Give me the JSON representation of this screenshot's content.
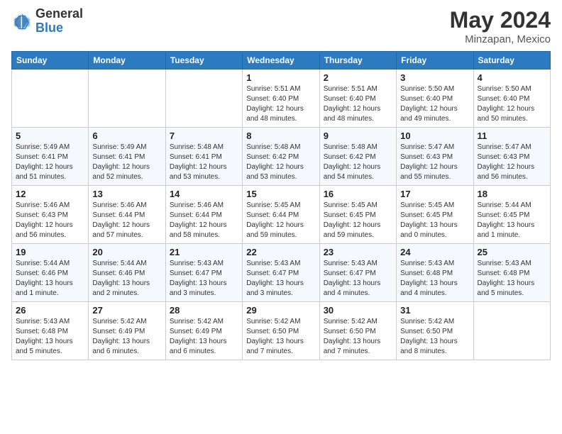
{
  "header": {
    "logo_general": "General",
    "logo_blue": "Blue",
    "month": "May 2024",
    "location": "Minzapan, Mexico"
  },
  "days_of_week": [
    "Sunday",
    "Monday",
    "Tuesday",
    "Wednesday",
    "Thursday",
    "Friday",
    "Saturday"
  ],
  "weeks": [
    [
      {
        "day": "",
        "detail": ""
      },
      {
        "day": "",
        "detail": ""
      },
      {
        "day": "",
        "detail": ""
      },
      {
        "day": "1",
        "detail": "Sunrise: 5:51 AM\nSunset: 6:40 PM\nDaylight: 12 hours\nand 48 minutes."
      },
      {
        "day": "2",
        "detail": "Sunrise: 5:51 AM\nSunset: 6:40 PM\nDaylight: 12 hours\nand 48 minutes."
      },
      {
        "day": "3",
        "detail": "Sunrise: 5:50 AM\nSunset: 6:40 PM\nDaylight: 12 hours\nand 49 minutes."
      },
      {
        "day": "4",
        "detail": "Sunrise: 5:50 AM\nSunset: 6:40 PM\nDaylight: 12 hours\nand 50 minutes."
      }
    ],
    [
      {
        "day": "5",
        "detail": "Sunrise: 5:49 AM\nSunset: 6:41 PM\nDaylight: 12 hours\nand 51 minutes."
      },
      {
        "day": "6",
        "detail": "Sunrise: 5:49 AM\nSunset: 6:41 PM\nDaylight: 12 hours\nand 52 minutes."
      },
      {
        "day": "7",
        "detail": "Sunrise: 5:48 AM\nSunset: 6:41 PM\nDaylight: 12 hours\nand 53 minutes."
      },
      {
        "day": "8",
        "detail": "Sunrise: 5:48 AM\nSunset: 6:42 PM\nDaylight: 12 hours\nand 53 minutes."
      },
      {
        "day": "9",
        "detail": "Sunrise: 5:48 AM\nSunset: 6:42 PM\nDaylight: 12 hours\nand 54 minutes."
      },
      {
        "day": "10",
        "detail": "Sunrise: 5:47 AM\nSunset: 6:43 PM\nDaylight: 12 hours\nand 55 minutes."
      },
      {
        "day": "11",
        "detail": "Sunrise: 5:47 AM\nSunset: 6:43 PM\nDaylight: 12 hours\nand 56 minutes."
      }
    ],
    [
      {
        "day": "12",
        "detail": "Sunrise: 5:46 AM\nSunset: 6:43 PM\nDaylight: 12 hours\nand 56 minutes."
      },
      {
        "day": "13",
        "detail": "Sunrise: 5:46 AM\nSunset: 6:44 PM\nDaylight: 12 hours\nand 57 minutes."
      },
      {
        "day": "14",
        "detail": "Sunrise: 5:46 AM\nSunset: 6:44 PM\nDaylight: 12 hours\nand 58 minutes."
      },
      {
        "day": "15",
        "detail": "Sunrise: 5:45 AM\nSunset: 6:44 PM\nDaylight: 12 hours\nand 59 minutes."
      },
      {
        "day": "16",
        "detail": "Sunrise: 5:45 AM\nSunset: 6:45 PM\nDaylight: 12 hours\nand 59 minutes."
      },
      {
        "day": "17",
        "detail": "Sunrise: 5:45 AM\nSunset: 6:45 PM\nDaylight: 13 hours\nand 0 minutes."
      },
      {
        "day": "18",
        "detail": "Sunrise: 5:44 AM\nSunset: 6:45 PM\nDaylight: 13 hours\nand 1 minute."
      }
    ],
    [
      {
        "day": "19",
        "detail": "Sunrise: 5:44 AM\nSunset: 6:46 PM\nDaylight: 13 hours\nand 1 minute."
      },
      {
        "day": "20",
        "detail": "Sunrise: 5:44 AM\nSunset: 6:46 PM\nDaylight: 13 hours\nand 2 minutes."
      },
      {
        "day": "21",
        "detail": "Sunrise: 5:43 AM\nSunset: 6:47 PM\nDaylight: 13 hours\nand 3 minutes."
      },
      {
        "day": "22",
        "detail": "Sunrise: 5:43 AM\nSunset: 6:47 PM\nDaylight: 13 hours\nand 3 minutes."
      },
      {
        "day": "23",
        "detail": "Sunrise: 5:43 AM\nSunset: 6:47 PM\nDaylight: 13 hours\nand 4 minutes."
      },
      {
        "day": "24",
        "detail": "Sunrise: 5:43 AM\nSunset: 6:48 PM\nDaylight: 13 hours\nand 4 minutes."
      },
      {
        "day": "25",
        "detail": "Sunrise: 5:43 AM\nSunset: 6:48 PM\nDaylight: 13 hours\nand 5 minutes."
      }
    ],
    [
      {
        "day": "26",
        "detail": "Sunrise: 5:43 AM\nSunset: 6:48 PM\nDaylight: 13 hours\nand 5 minutes."
      },
      {
        "day": "27",
        "detail": "Sunrise: 5:42 AM\nSunset: 6:49 PM\nDaylight: 13 hours\nand 6 minutes."
      },
      {
        "day": "28",
        "detail": "Sunrise: 5:42 AM\nSunset: 6:49 PM\nDaylight: 13 hours\nand 6 minutes."
      },
      {
        "day": "29",
        "detail": "Sunrise: 5:42 AM\nSunset: 6:50 PM\nDaylight: 13 hours\nand 7 minutes."
      },
      {
        "day": "30",
        "detail": "Sunrise: 5:42 AM\nSunset: 6:50 PM\nDaylight: 13 hours\nand 7 minutes."
      },
      {
        "day": "31",
        "detail": "Sunrise: 5:42 AM\nSunset: 6:50 PM\nDaylight: 13 hours\nand 8 minutes."
      },
      {
        "day": "",
        "detail": ""
      }
    ]
  ]
}
